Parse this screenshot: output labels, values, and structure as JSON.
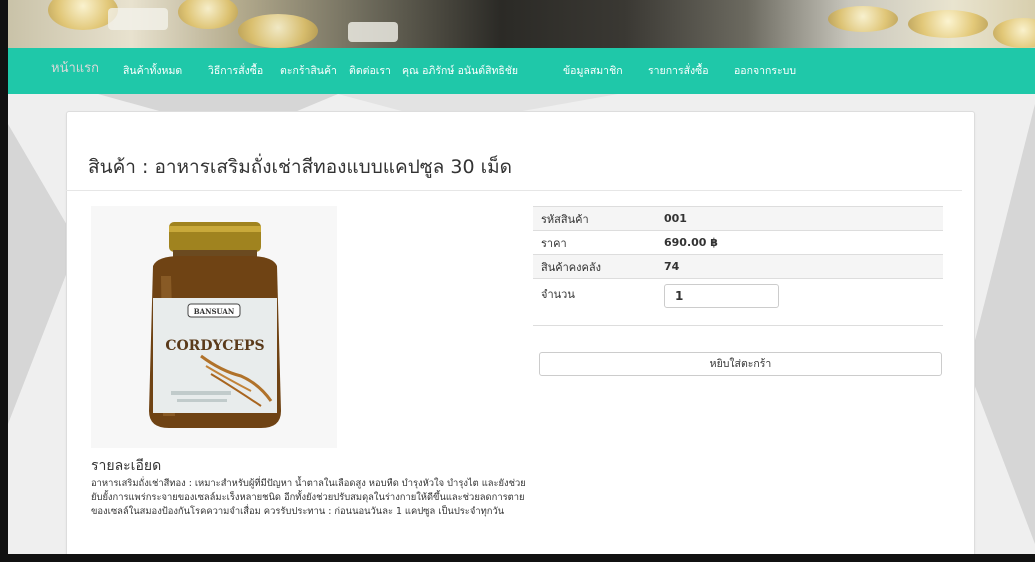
{
  "navbar": {
    "items": [
      {
        "label": "หน้าแรก"
      },
      {
        "label": "สินค้าทั้งหมด"
      },
      {
        "label": "วิธีการสั่งซื้อ"
      },
      {
        "label": "ตะกร้าสินค้า"
      },
      {
        "label": "ติดต่อเรา"
      },
      {
        "label": "คุณ อภิรักษ์ อนันต์สิทธิชัย"
      },
      {
        "label": "ข้อมูลสมาชิก"
      },
      {
        "label": "รายการสั่งซื้อ"
      },
      {
        "label": "ออกจากระบบ"
      }
    ],
    "accent": "#1fc8a9"
  },
  "product": {
    "title": "สินค้า : อาหารเสริมถั่งเช่าสีทองแบบแคปซูล 30 เม็ด",
    "image_brand": "BANSUAN",
    "image_name": "CORDYCEPS",
    "info": {
      "code_label": "รหัสสินค้า",
      "code_value": "001",
      "price_label": "ราคา",
      "price_value": "690.00 ฿",
      "stock_label": "สินค้าคงคลัง",
      "stock_value": "74",
      "qty_label": "จำนวน",
      "qty_value": "1"
    },
    "add_to_cart": "หยิบใส่ตะกร้า",
    "details_heading": "รายละเอียด",
    "details_text": "อาหารเสริมถั่งเช่าสีทอง : เหมาะสำหรับผู้ที่มีปัญหา น้ำตาลในเลือดสูง หอบหืด บำรุงหัวใจ บำรุงไต และยังช่วยยับยั้งการแพร่กระจายของเซลล์มะเร็งหลายชนิด อีกทั้งยังช่วยปรับสมดุลในร่างกายให้ดีขึ้นและช่วยลดการตายของเซลล์ในสมองป้องกันโรคความจำเสื่อม ควรรับประทาน : ก่อนนอนวันละ 1 แคปซูล เป็นประจำทุกวัน"
  }
}
